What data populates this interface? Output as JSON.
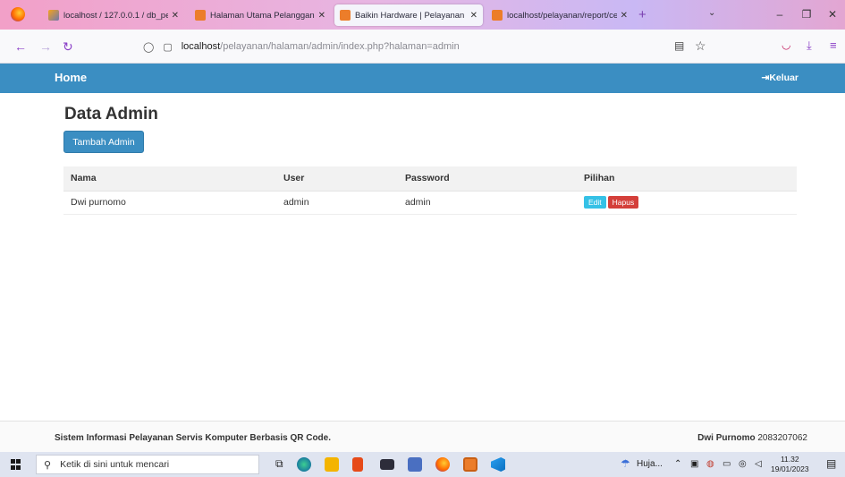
{
  "browser": {
    "tabs": [
      {
        "title": "localhost / 127.0.0.1 / db_pelay",
        "active": false
      },
      {
        "title": "Halaman Utama Pelanggan",
        "active": false
      },
      {
        "title": "Baikin Hardware | Pelayanan Se",
        "active": true
      },
      {
        "title": "localhost/pelayanan/report/cet",
        "active": false
      }
    ],
    "url_host": "localhost",
    "url_path": "/pelayanan/halaman/admin/index.php?halaman=admin"
  },
  "header": {
    "home_label": "Home",
    "logout_label": "Keluar"
  },
  "main": {
    "title": "Data Admin",
    "add_button_label": "Tambah Admin",
    "table": {
      "columns": [
        "Nama",
        "User",
        "Password",
        "Pilihan"
      ],
      "rows": [
        {
          "nama": "Dwi purnomo",
          "user": "admin",
          "password": "admin"
        }
      ],
      "edit_label": "Edit",
      "delete_label": "Hapus"
    }
  },
  "footer": {
    "left_text": "Sistem Informasi Pelayanan Servis Komputer Berbasis QR Code.",
    "author_name": "Dwi Purnomo",
    "author_id": "2083207062"
  },
  "taskbar": {
    "search_placeholder": "Ketik di sini untuk mencari",
    "weather_text": "Huja...",
    "time": "11.32",
    "date": "19/01/2023"
  },
  "colors": {
    "primary": "#3b8ec2",
    "info": "#35c1e6",
    "danger": "#d43f3a"
  }
}
